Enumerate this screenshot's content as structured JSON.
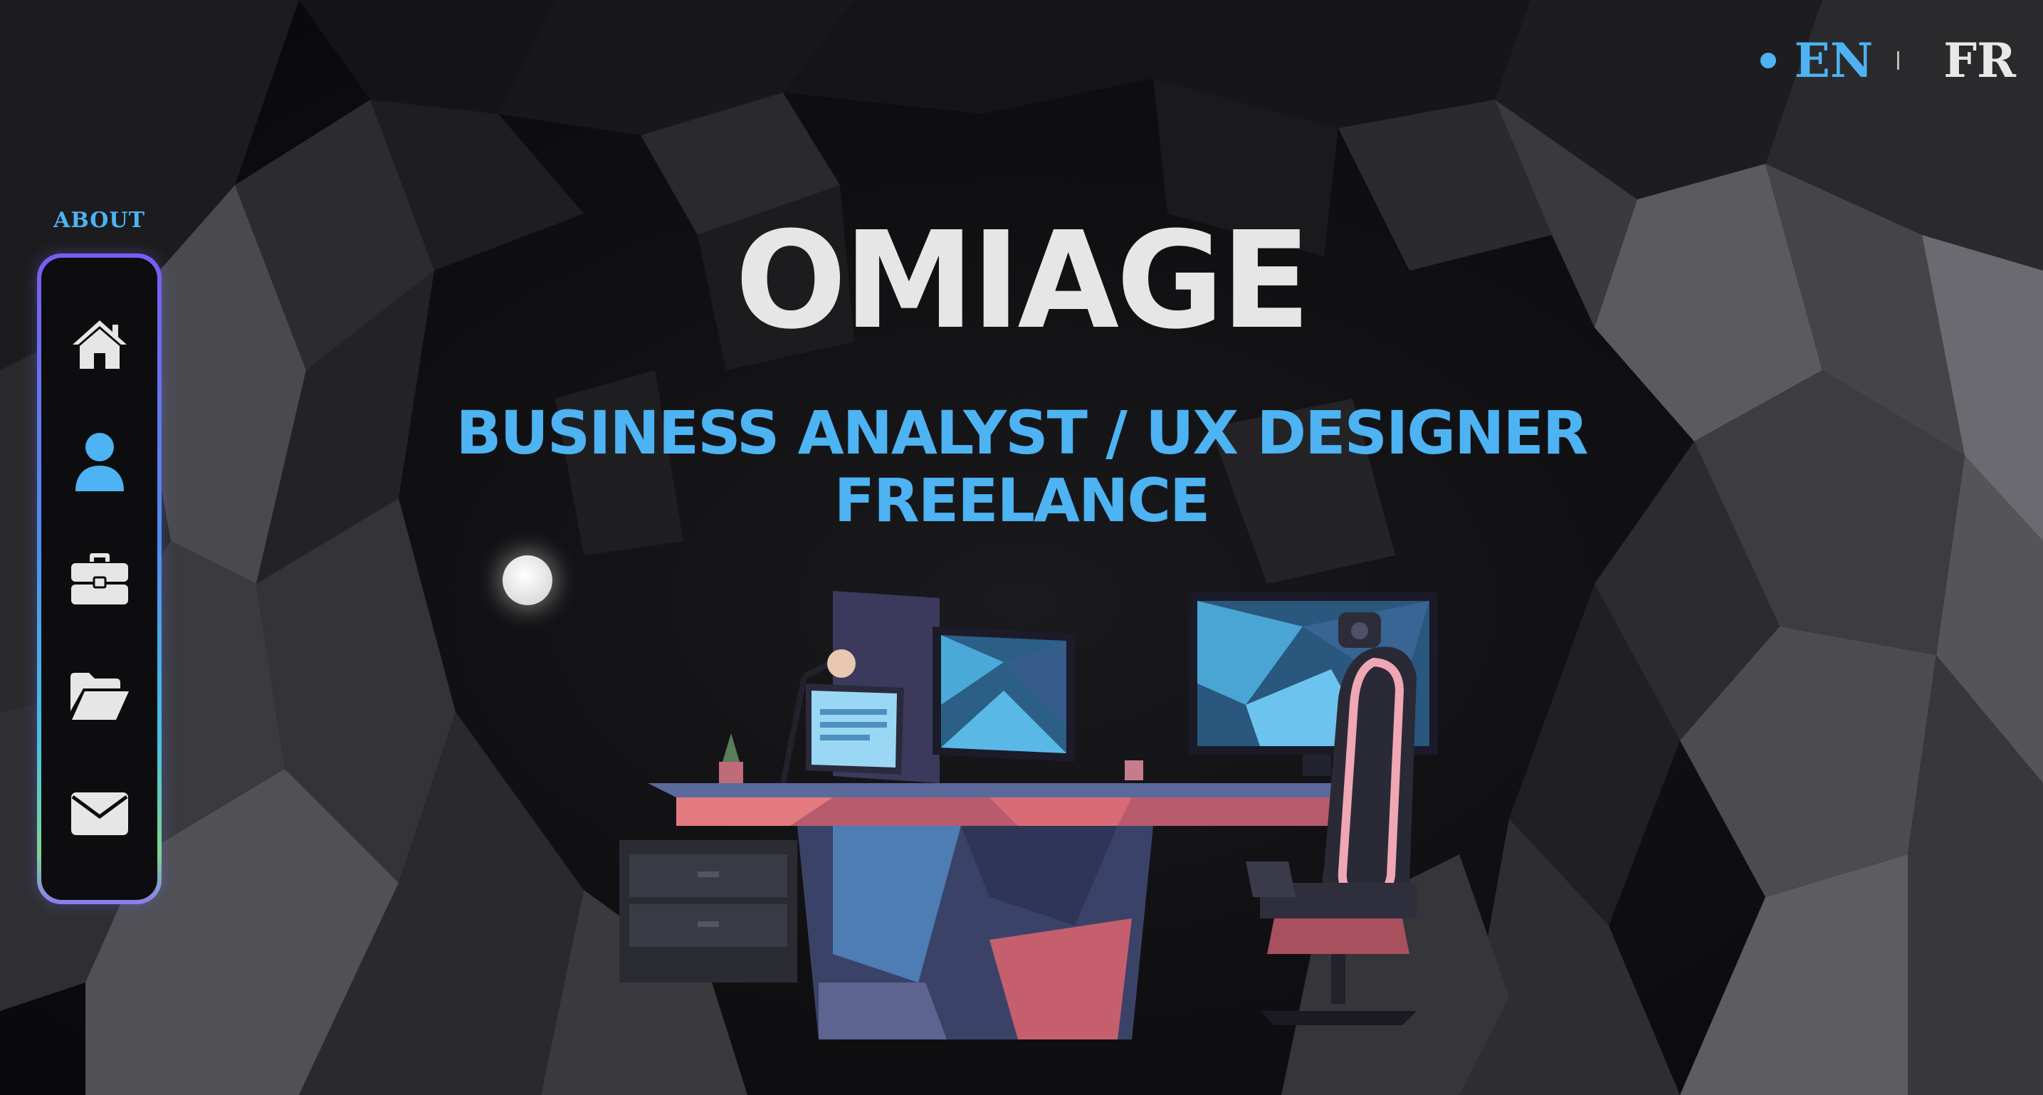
{
  "language": {
    "active": "EN",
    "other": "FR",
    "active_color": "#4db3f2"
  },
  "nav": {
    "caption": "ABOUT",
    "items": [
      {
        "id": "home",
        "icon": "home-icon",
        "active": false
      },
      {
        "id": "about",
        "icon": "user-icon",
        "active": true
      },
      {
        "id": "work",
        "icon": "briefcase-icon",
        "active": false
      },
      {
        "id": "projects",
        "icon": "folder-open-icon",
        "active": false
      },
      {
        "id": "contact",
        "icon": "envelope-icon",
        "active": false
      }
    ]
  },
  "hero": {
    "title": "OMIAGE",
    "subtitle_line1": "BUSINESS ANALYST / UX DESIGNER",
    "subtitle_line2": "FREELANCE"
  },
  "colors": {
    "accent": "#4db3f2",
    "text": "#e6e6e6",
    "background": "#0b0b0c"
  }
}
